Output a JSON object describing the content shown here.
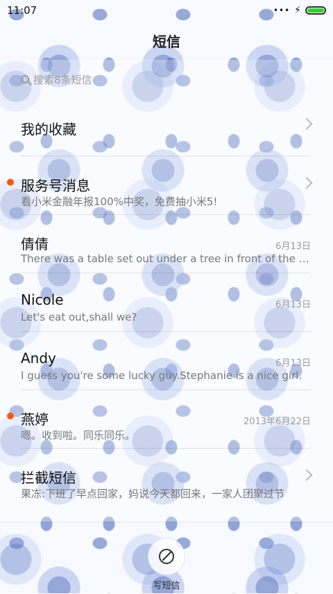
{
  "status_bar": {
    "time": "11:07",
    "signal_icon": "signal-dots-icon",
    "charging_icon": "bolt-icon",
    "battery_icon": "battery-icon",
    "battery_color": "#2fd12f"
  },
  "header": {
    "title": "短信"
  },
  "search": {
    "placeholder": "搜索8条短信",
    "icon": "search-icon"
  },
  "conversations": [
    {
      "name": "我的收藏",
      "preview": "",
      "date": "",
      "unread": false,
      "chevron": true
    },
    {
      "name": "服务号消息",
      "preview": "看小米金融年报100%中奖，免费抽小米5!",
      "date": "",
      "unread": true,
      "chevron": true
    },
    {
      "name": "倩倩",
      "preview": "There was a table set out under a tree in front of the house",
      "date": "6月13日",
      "unread": false,
      "chevron": false
    },
    {
      "name": "Nicole",
      "preview": "Let's eat out,shall we?",
      "date": "6月13日",
      "unread": false,
      "chevron": false
    },
    {
      "name": "Andy",
      "preview": "I guess you're some lucky guy.Stephanie is a nice girl.",
      "date": "6月13日",
      "unread": false,
      "chevron": false
    },
    {
      "name": "燕婷",
      "preview": "嗯。收到啦。同乐同乐。",
      "date": "2013年6月22日",
      "unread": true,
      "chevron": false
    },
    {
      "name": "拦截短信",
      "preview": "果冻:下班了早点回家，妈说今天都回来，一家人团聚过节",
      "date": "",
      "unread": false,
      "chevron": true
    }
  ],
  "compose": {
    "label": "写短信",
    "icon": "compose-icon"
  },
  "colors": {
    "accent_unread": "#f45a14",
    "wallpaper_blue": "#4a68b8"
  }
}
